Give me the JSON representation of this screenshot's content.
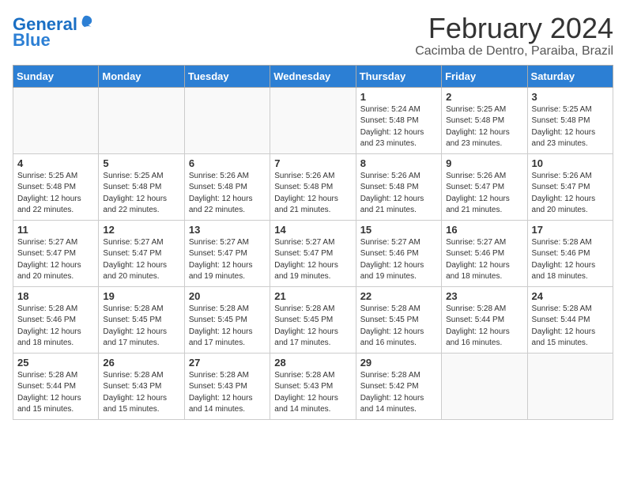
{
  "logo": {
    "text_general": "General",
    "text_blue": "Blue"
  },
  "title": {
    "month_year": "February 2024",
    "location": "Cacimba de Dentro, Paraiba, Brazil"
  },
  "header_days": [
    "Sunday",
    "Monday",
    "Tuesday",
    "Wednesday",
    "Thursday",
    "Friday",
    "Saturday"
  ],
  "weeks": [
    [
      {
        "day": "",
        "info": ""
      },
      {
        "day": "",
        "info": ""
      },
      {
        "day": "",
        "info": ""
      },
      {
        "day": "",
        "info": ""
      },
      {
        "day": "1",
        "info": "Sunrise: 5:24 AM\nSunset: 5:48 PM\nDaylight: 12 hours\nand 23 minutes."
      },
      {
        "day": "2",
        "info": "Sunrise: 5:25 AM\nSunset: 5:48 PM\nDaylight: 12 hours\nand 23 minutes."
      },
      {
        "day": "3",
        "info": "Sunrise: 5:25 AM\nSunset: 5:48 PM\nDaylight: 12 hours\nand 23 minutes."
      }
    ],
    [
      {
        "day": "4",
        "info": "Sunrise: 5:25 AM\nSunset: 5:48 PM\nDaylight: 12 hours\nand 22 minutes."
      },
      {
        "day": "5",
        "info": "Sunrise: 5:25 AM\nSunset: 5:48 PM\nDaylight: 12 hours\nand 22 minutes."
      },
      {
        "day": "6",
        "info": "Sunrise: 5:26 AM\nSunset: 5:48 PM\nDaylight: 12 hours\nand 22 minutes."
      },
      {
        "day": "7",
        "info": "Sunrise: 5:26 AM\nSunset: 5:48 PM\nDaylight: 12 hours\nand 21 minutes."
      },
      {
        "day": "8",
        "info": "Sunrise: 5:26 AM\nSunset: 5:48 PM\nDaylight: 12 hours\nand 21 minutes."
      },
      {
        "day": "9",
        "info": "Sunrise: 5:26 AM\nSunset: 5:47 PM\nDaylight: 12 hours\nand 21 minutes."
      },
      {
        "day": "10",
        "info": "Sunrise: 5:26 AM\nSunset: 5:47 PM\nDaylight: 12 hours\nand 20 minutes."
      }
    ],
    [
      {
        "day": "11",
        "info": "Sunrise: 5:27 AM\nSunset: 5:47 PM\nDaylight: 12 hours\nand 20 minutes."
      },
      {
        "day": "12",
        "info": "Sunrise: 5:27 AM\nSunset: 5:47 PM\nDaylight: 12 hours\nand 20 minutes."
      },
      {
        "day": "13",
        "info": "Sunrise: 5:27 AM\nSunset: 5:47 PM\nDaylight: 12 hours\nand 19 minutes."
      },
      {
        "day": "14",
        "info": "Sunrise: 5:27 AM\nSunset: 5:47 PM\nDaylight: 12 hours\nand 19 minutes."
      },
      {
        "day": "15",
        "info": "Sunrise: 5:27 AM\nSunset: 5:46 PM\nDaylight: 12 hours\nand 19 minutes."
      },
      {
        "day": "16",
        "info": "Sunrise: 5:27 AM\nSunset: 5:46 PM\nDaylight: 12 hours\nand 18 minutes."
      },
      {
        "day": "17",
        "info": "Sunrise: 5:28 AM\nSunset: 5:46 PM\nDaylight: 12 hours\nand 18 minutes."
      }
    ],
    [
      {
        "day": "18",
        "info": "Sunrise: 5:28 AM\nSunset: 5:46 PM\nDaylight: 12 hours\nand 18 minutes."
      },
      {
        "day": "19",
        "info": "Sunrise: 5:28 AM\nSunset: 5:45 PM\nDaylight: 12 hours\nand 17 minutes."
      },
      {
        "day": "20",
        "info": "Sunrise: 5:28 AM\nSunset: 5:45 PM\nDaylight: 12 hours\nand 17 minutes."
      },
      {
        "day": "21",
        "info": "Sunrise: 5:28 AM\nSunset: 5:45 PM\nDaylight: 12 hours\nand 17 minutes."
      },
      {
        "day": "22",
        "info": "Sunrise: 5:28 AM\nSunset: 5:45 PM\nDaylight: 12 hours\nand 16 minutes."
      },
      {
        "day": "23",
        "info": "Sunrise: 5:28 AM\nSunset: 5:44 PM\nDaylight: 12 hours\nand 16 minutes."
      },
      {
        "day": "24",
        "info": "Sunrise: 5:28 AM\nSunset: 5:44 PM\nDaylight: 12 hours\nand 15 minutes."
      }
    ],
    [
      {
        "day": "25",
        "info": "Sunrise: 5:28 AM\nSunset: 5:44 PM\nDaylight: 12 hours\nand 15 minutes."
      },
      {
        "day": "26",
        "info": "Sunrise: 5:28 AM\nSunset: 5:43 PM\nDaylight: 12 hours\nand 15 minutes."
      },
      {
        "day": "27",
        "info": "Sunrise: 5:28 AM\nSunset: 5:43 PM\nDaylight: 12 hours\nand 14 minutes."
      },
      {
        "day": "28",
        "info": "Sunrise: 5:28 AM\nSunset: 5:43 PM\nDaylight: 12 hours\nand 14 minutes."
      },
      {
        "day": "29",
        "info": "Sunrise: 5:28 AM\nSunset: 5:42 PM\nDaylight: 12 hours\nand 14 minutes."
      },
      {
        "day": "",
        "info": ""
      },
      {
        "day": "",
        "info": ""
      }
    ]
  ]
}
